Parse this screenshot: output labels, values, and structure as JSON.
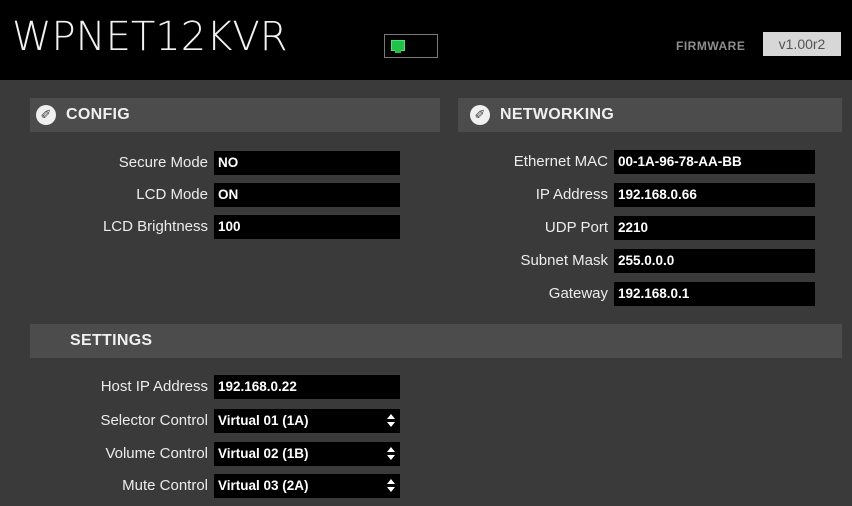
{
  "header": {
    "title": "WPNET12KVR",
    "firmware_label": "FIRMWARE",
    "firmware_value": "v1.00r2",
    "status_icon": "network-status-icon"
  },
  "config": {
    "title": "CONFIG",
    "icon": "wrench-icon",
    "fields": [
      {
        "label": "Secure Mode",
        "value": "NO"
      },
      {
        "label": "LCD Mode",
        "value": "ON"
      },
      {
        "label": "LCD Brightness",
        "value": "100"
      }
    ]
  },
  "networking": {
    "title": "NETWORKING",
    "icon": "wrench-icon",
    "fields": [
      {
        "label": "Ethernet MAC",
        "value": "00-1A-96-78-AA-BB"
      },
      {
        "label": "IP Address",
        "value": "192.168.0.66"
      },
      {
        "label": "UDP Port",
        "value": "2210"
      },
      {
        "label": "Subnet Mask",
        "value": "255.0.0.0"
      },
      {
        "label": "Gateway",
        "value": "192.168.0.1"
      }
    ]
  },
  "settings": {
    "title": "SETTINGS",
    "host_ip": {
      "label": "Host IP Address",
      "value": "192.168.0.22"
    },
    "selects": [
      {
        "label": "Selector Control",
        "value": "Virtual 01 (1A)"
      },
      {
        "label": "Volume Control",
        "value": "Virtual 02 (1B)"
      },
      {
        "label": "Mute Control",
        "value": "Virtual 03 (2A)"
      }
    ]
  },
  "colors": {
    "background": "#3a3a3a",
    "header": "#000000",
    "section_bar": "#4c4c4c",
    "field": "#000000",
    "status_led": "#21c24a"
  }
}
